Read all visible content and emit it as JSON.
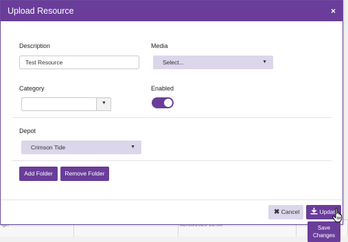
{
  "background": {
    "row": [
      "ign",
      "",
      "02/03/2020 22:58",
      ""
    ]
  },
  "modal": {
    "title": "Upload Resource",
    "close_glyph": "×",
    "description": {
      "label": "Description",
      "value": "Test Resource"
    },
    "media": {
      "label": "Media",
      "value": "Select..."
    },
    "category": {
      "label": "Category",
      "value": ""
    },
    "enabled": {
      "label": "Enabled",
      "on": true
    },
    "depot": {
      "label": "Depot",
      "value": "Crimson Tide"
    },
    "buttons": {
      "add_folder": "Add Folder",
      "remove_folder": "Remove Folder",
      "cancel": "Cancel",
      "update": "Update"
    },
    "tooltip": "Save Changes"
  },
  "colors": {
    "accent": "#6a3d9a",
    "select_bg": "#dcd6ea"
  },
  "icons": {
    "close": "close-icon",
    "caret": "caret-down-icon",
    "cancel": "x-icon",
    "update": "download-icon",
    "cursor": "hand-pointer-icon"
  }
}
